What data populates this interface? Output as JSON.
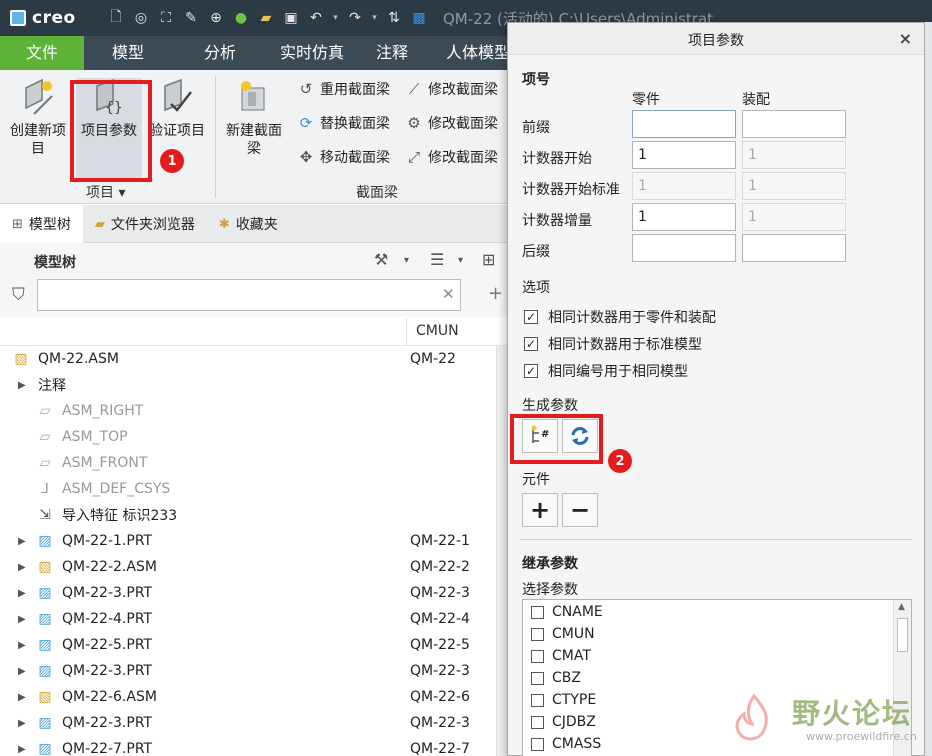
{
  "app": {
    "logo_text": "creo",
    "window_title": "QM-22 (活动的) C:\\Users\\Administrat"
  },
  "menu": [
    "文件",
    "模型",
    "分析",
    "实时仿真",
    "注释",
    "人体模型"
  ],
  "ribbon": {
    "group_item": {
      "label": "项目 ▾",
      "buttons": [
        "创建新项\n目",
        "项目参数",
        "验证项目"
      ]
    },
    "group_beam": {
      "label": "截面梁",
      "new_beam": "新建截面\n梁",
      "small_buttons": [
        "重用截面梁",
        "修改截面梁",
        "替换截面梁",
        "修改截面梁",
        "移动截面梁",
        "修改截面梁"
      ]
    },
    "badges": [
      "1",
      "2"
    ]
  },
  "tabs": [
    "模型树",
    "文件夹浏览器",
    "收藏夹"
  ],
  "tree": {
    "title": "模型树",
    "filter_placeholder": "",
    "column": "CMUN",
    "rows": [
      {
        "label": "QM-22.ASM",
        "value": "QM-22",
        "icon": "assembly-icon"
      },
      {
        "label": "注释",
        "value": "",
        "icon": ""
      },
      {
        "label": "ASM_RIGHT",
        "value": "",
        "icon": "datum-plane-icon"
      },
      {
        "label": "ASM_TOP",
        "value": "",
        "icon": "datum-plane-icon"
      },
      {
        "label": "ASM_FRONT",
        "value": "",
        "icon": "datum-plane-icon"
      },
      {
        "label": "ASM_DEF_CSYS",
        "value": "",
        "icon": "csys-icon"
      },
      {
        "label": "导入特征 标识233",
        "value": "",
        "icon": "import-feature-icon"
      },
      {
        "label": "QM-22-1.PRT",
        "value": "QM-22-1",
        "icon": "part-icon"
      },
      {
        "label": "QM-22-2.ASM",
        "value": "QM-22-2",
        "icon": "assembly-icon"
      },
      {
        "label": "QM-22-3.PRT",
        "value": "QM-22-3",
        "icon": "part-icon"
      },
      {
        "label": "QM-22-4.PRT",
        "value": "QM-22-4",
        "icon": "part-icon"
      },
      {
        "label": "QM-22-5.PRT",
        "value": "QM-22-5",
        "icon": "part-icon"
      },
      {
        "label": "QM-22-3.PRT",
        "value": "QM-22-3",
        "icon": "part-icon"
      },
      {
        "label": "QM-22-6.ASM",
        "value": "QM-22-6",
        "icon": "assembly-icon"
      },
      {
        "label": "QM-22-3.PRT",
        "value": "QM-22-3",
        "icon": "part-icon"
      },
      {
        "label": "QM-22-7.PRT",
        "value": "QM-22-7",
        "icon": "part-icon"
      }
    ]
  },
  "dialog": {
    "title": "项目参数",
    "close": "×",
    "section_item": "项号",
    "col_part": "零件",
    "col_asm": "装配",
    "fields": [
      {
        "label": "前缀",
        "part": "",
        "asm": ""
      },
      {
        "label": "计数器开始",
        "part": "1",
        "asm": "1"
      },
      {
        "label": "计数器开始标准",
        "part": "1",
        "asm": "1"
      },
      {
        "label": "计数器增量",
        "part": "1",
        "asm": "1"
      },
      {
        "label": "后缀",
        "part": "",
        "asm": ""
      }
    ],
    "section_options": "选项",
    "options": [
      "相同计数器用于零件和装配",
      "相同计数器用于标准模型",
      "相同编号用于相同模型"
    ],
    "section_generate": "生成参数",
    "section_component": "元件",
    "section_inherit": "继承参数",
    "select_params": "选择参数",
    "params": [
      "CNAME",
      "CMUN",
      "CMAT",
      "CBZ",
      "CTYPE",
      "CJDBZ",
      "CMASS"
    ]
  },
  "watermark": {
    "main": "野火论坛",
    "sub": "www.proewildfire.cn"
  },
  "colors": {
    "titlebar": "#2b3a45",
    "menubar": "#3b4a55",
    "file_tab": "#5cb338",
    "highlight": "#e41c1c"
  }
}
